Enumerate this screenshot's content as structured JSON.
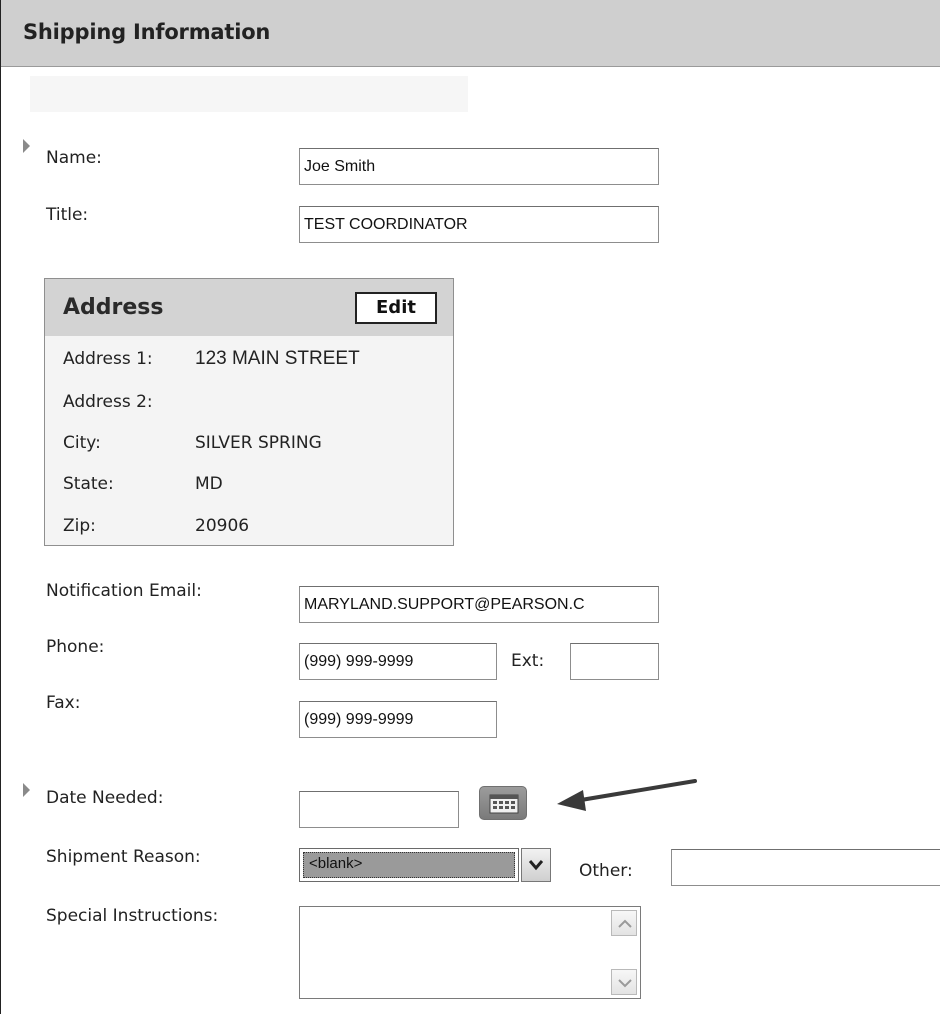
{
  "header": {
    "title": "Shipping Information"
  },
  "form": {
    "name": {
      "label": "Name:",
      "value": "Joe Smith"
    },
    "title": {
      "label": "Title:",
      "value": "TEST COORDINATOR"
    },
    "address": {
      "heading": "Address",
      "edit_label": "Edit",
      "rows": [
        {
          "label": "Address 1:",
          "value": "123 MAIN STREET"
        },
        {
          "label": "Address 2:",
          "value": ""
        },
        {
          "label": "City:",
          "value": "SILVER SPRING"
        },
        {
          "label": "State:",
          "value": "MD"
        },
        {
          "label": "Zip:",
          "value": "20906"
        }
      ]
    },
    "notification_email": {
      "label": "Notification Email:",
      "value": "MARYLAND.SUPPORT@PEARSON.C"
    },
    "phone": {
      "label": "Phone:",
      "value": "(999) 999-9999"
    },
    "ext": {
      "label": "Ext:",
      "value": ""
    },
    "fax": {
      "label": "Fax:",
      "value": "(999) 999-9999"
    },
    "date_needed": {
      "label": "Date Needed:",
      "value": ""
    },
    "shipment_reason": {
      "label": "Shipment Reason:",
      "selected": "<blank>"
    },
    "other": {
      "label": "Other:",
      "value": ""
    },
    "special_instructions": {
      "label": "Special Instructions:",
      "value": ""
    }
  },
  "icons": {
    "required_marker": "triangle-marker-icon",
    "calendar": "calendar-icon",
    "dropdown": "chevron-down-icon",
    "annotation_arrow": "arrow-icon"
  },
  "colors": {
    "header_bg": "#cfcfcf",
    "address_bg": "#f4f4f4",
    "address_head_bg": "#d3d3d3"
  }
}
